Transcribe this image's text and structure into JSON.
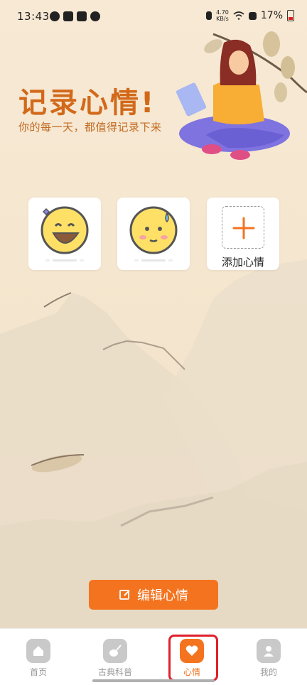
{
  "status_bar": {
    "time": "13:43",
    "net_speed_value": "4.70",
    "net_speed_unit": "KB/s",
    "battery_percent": "17%"
  },
  "header": {
    "title": "记录心情!",
    "subtitle": "你的每一天，都值得记录下来"
  },
  "mood_cards": [
    {
      "icon": "laughing-face-icon"
    },
    {
      "icon": "sweat-face-icon"
    },
    {
      "icon": "add-icon",
      "label": "添加心情"
    }
  ],
  "edit_button": {
    "label": "编辑心情"
  },
  "tabs": [
    {
      "label": "首页",
      "icon": "home-icon",
      "active": false
    },
    {
      "label": "古典科普",
      "icon": "pipa-icon",
      "active": false
    },
    {
      "label": "心情",
      "icon": "heart-icon",
      "active": true
    },
    {
      "label": "我的",
      "icon": "user-icon",
      "active": false
    }
  ],
  "colors": {
    "accent": "#f4731f",
    "title": "#d2691a",
    "highlight": "#e0202a",
    "background": "#f6e8d2"
  }
}
